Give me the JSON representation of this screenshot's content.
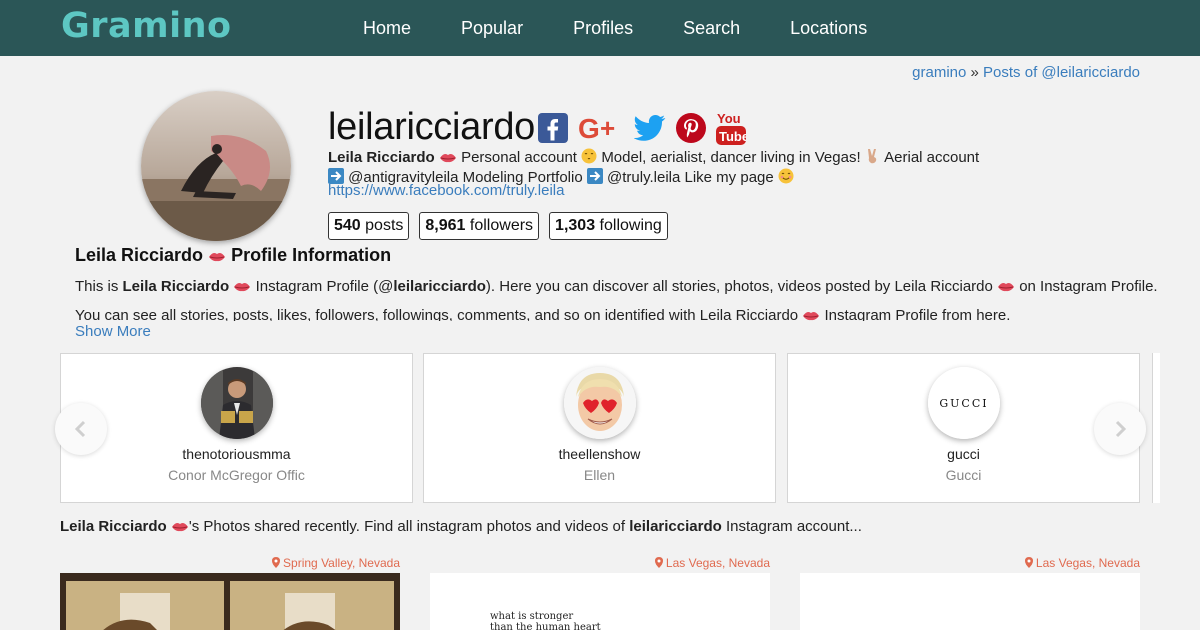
{
  "header": {
    "logo": "Gramino",
    "nav": [
      "Home",
      "Popular",
      "Profiles",
      "Search",
      "Locations"
    ]
  },
  "breadcrumb": {
    "home": "gramino",
    "separator": "»",
    "current": "Posts of @leilaricciardo"
  },
  "profile": {
    "username": "leilaricciardo",
    "socials": [
      "facebook-icon",
      "google-plus-icon",
      "twitter-icon",
      "pinterest-icon",
      "youtube-icon"
    ],
    "bio_name": "Leila Ricciardo",
    "bio_line1_a": "Personal account",
    "bio_line1_b": "Model, aerialist, dancer living in Vegas!",
    "bio_line1_c": "Aerial account",
    "bio_line2_a": "@antigravityleila Modeling Portfolio",
    "bio_line2_b": "@truly.leila Like my page",
    "link": "https://www.facebook.com/truly.leila",
    "stats": {
      "posts_num": "540",
      "posts_label": "posts",
      "followers_num": "8,961",
      "followers_label": "followers",
      "following_num": "1,303",
      "following_label": "following"
    }
  },
  "info": {
    "title_name": "Leila Ricciardo",
    "title_suffix": "Profile Information",
    "p1_a": "This is",
    "p1_name": "Leila Ricciardo",
    "p1_b": "Instagram Profile (@",
    "p1_handle": "leilaricciardo",
    "p1_c": "). Here you can discover all stories, photos, videos posted by Leila Ricciardo",
    "p1_d": "on Instagram Profile.",
    "p2_a": "You can see all stories, posts, likes, followers, followings, comments, and so on identified with Leila Ricciardo",
    "p2_b": "Instagram Profile from here.",
    "show_more": "Show More"
  },
  "carousel": {
    "cards": [
      {
        "handle": "thenotoriousmma",
        "name": "Conor McGregor Offic"
      },
      {
        "handle": "theellenshow",
        "name": "Ellen"
      },
      {
        "handle": "gucci",
        "name": "Gucci",
        "logo": "GUCCI"
      }
    ]
  },
  "recent": {
    "name": "Leila Ricciardo",
    "mid": "'s Photos shared recently. Find all instagram photos and videos of",
    "handle": "leilaricciardo",
    "end": "Instagram account..."
  },
  "photos": [
    {
      "location": "Spring Valley, Nevada"
    },
    {
      "location": "Las Vegas, Nevada",
      "caption_1": "what is stronger",
      "caption_2": "than the human heart"
    },
    {
      "location": "Las Vegas, Nevada"
    }
  ],
  "colors": {
    "header_bg": "#2b5657",
    "logo": "#5dc7c3",
    "link": "#3a7dbd",
    "location": "#e06a4f",
    "facebook": "#3b5998",
    "google": "#dd4b39",
    "twitter": "#1da1f2",
    "pinterest": "#bd081c",
    "youtube": "#cd201f"
  }
}
